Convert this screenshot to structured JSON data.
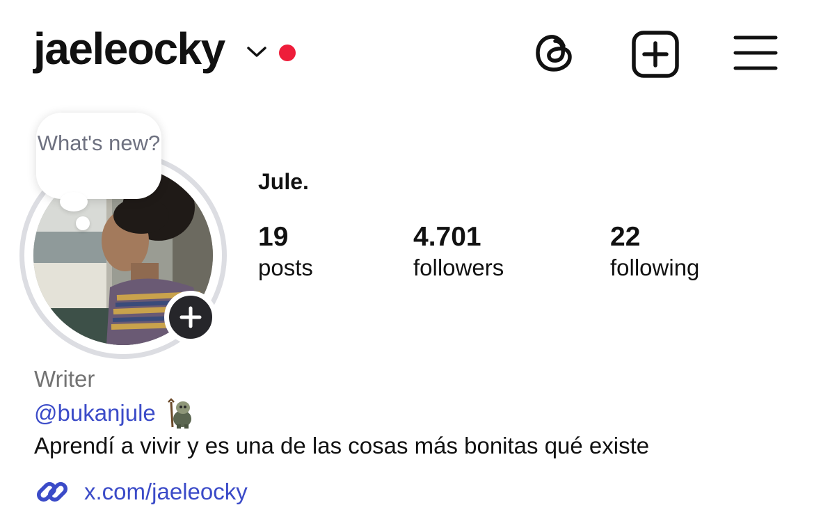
{
  "header": {
    "username": "jaeleocky",
    "icons": [
      "chevron-down-icon",
      "notification-dot-icon",
      "threads-icon",
      "create-post-icon",
      "menu-icon"
    ],
    "notification_color": "#ee1d3a"
  },
  "profile": {
    "note_text": "What's new?",
    "full_name": "Jule.",
    "stats": [
      {
        "value": "19",
        "label": "posts"
      },
      {
        "value": "4.701",
        "label": "followers"
      },
      {
        "value": "22",
        "label": "following"
      }
    ],
    "category": "Writer",
    "threads_handle": "@bukanjule",
    "bio": "Aprendí a vivir y es una de las cosas más bonitas qué existe",
    "link": "x.com/jaeleocky"
  },
  "colors": {
    "link_blue": "#3b4bc8",
    "text": "#111111",
    "muted": "#737373"
  }
}
